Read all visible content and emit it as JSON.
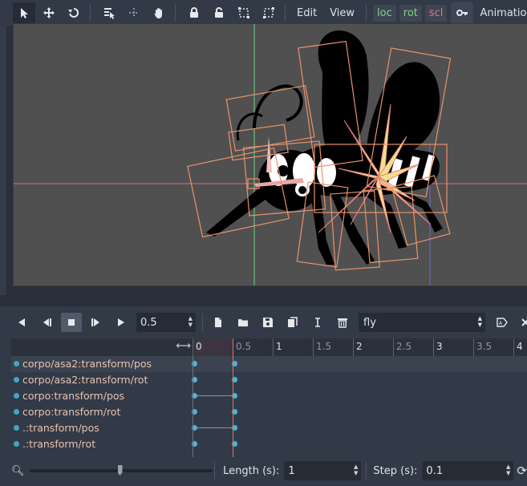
{
  "toolbar": {
    "menus": {
      "edit": "Edit",
      "view": "View",
      "animation": "Animation"
    },
    "keying": {
      "loc": "loc",
      "rot": "rot",
      "scl": "scl"
    },
    "colors": {
      "loc": "#7fd67f",
      "rot": "#7fd67f",
      "scl": "#e07a7a"
    }
  },
  "animation": {
    "current_time": "0.5",
    "selected_animation": "fly",
    "ruler_labels": [
      "0",
      "0.5",
      "1",
      "1.5",
      "2",
      "2.5",
      "3",
      "3.5",
      "4"
    ],
    "tracks": [
      {
        "name": "corpo/asa2:transform/pos",
        "keys": [
          0,
          0.5
        ]
      },
      {
        "name": "corpo/asa2:transform/rot",
        "keys": [
          0,
          0.5
        ]
      },
      {
        "name": "corpo:transform/pos",
        "keys": [
          0,
          0.5
        ]
      },
      {
        "name": "corpo:transform/rot",
        "keys": [
          0,
          0.5
        ]
      },
      {
        "name": ".:transform/pos",
        "keys": [
          0,
          0.5
        ]
      },
      {
        "name": ".:transform/rot",
        "keys": [
          0,
          0.5
        ]
      }
    ],
    "length_label": "Length (s):",
    "length_value": "1",
    "step_label": "Step (s):",
    "step_value": "0.1"
  }
}
